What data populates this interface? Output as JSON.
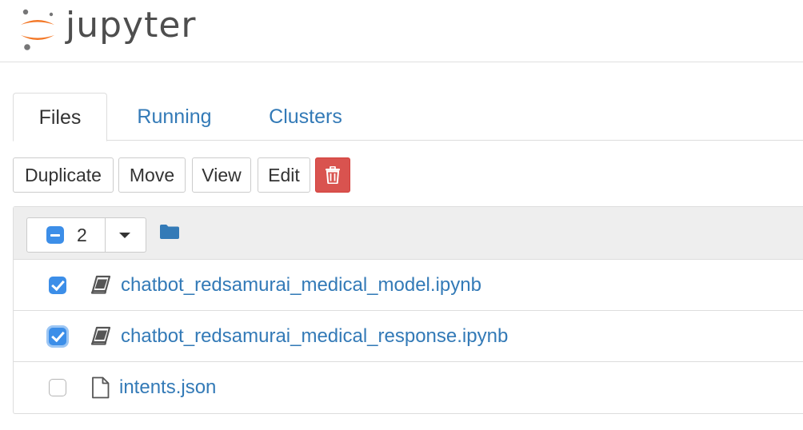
{
  "header": {
    "logo_text": "jupyter",
    "logo_icon": "jupyter-logo",
    "colors": {
      "logo_orange": "#f37726",
      "logo_gray": "#767677"
    }
  },
  "tabs": [
    {
      "label": "Files",
      "active": true
    },
    {
      "label": "Running",
      "active": false
    },
    {
      "label": "Clusters",
      "active": false
    }
  ],
  "toolbar": {
    "duplicate_label": "Duplicate",
    "move_label": "Move",
    "view_label": "View",
    "edit_label": "Edit",
    "delete_icon": "trash-icon",
    "delete_color": "#d9534f"
  },
  "list": {
    "selected_count": "2",
    "header_icons": [
      "select-partial-icon",
      "caret-down-icon",
      "folder-icon"
    ],
    "items": [
      {
        "name": "chatbot_redsamurai_medical_model.ipynb",
        "icon": "notebook-icon",
        "checked": true
      },
      {
        "name": "chatbot_redsamurai_medical_response.ipynb",
        "icon": "notebook-icon",
        "checked": true
      },
      {
        "name": "intents.json",
        "icon": "file-icon",
        "checked": false
      }
    ]
  },
  "colors": {
    "link": "#337ab7",
    "checkbox": "#3c8ee8"
  }
}
